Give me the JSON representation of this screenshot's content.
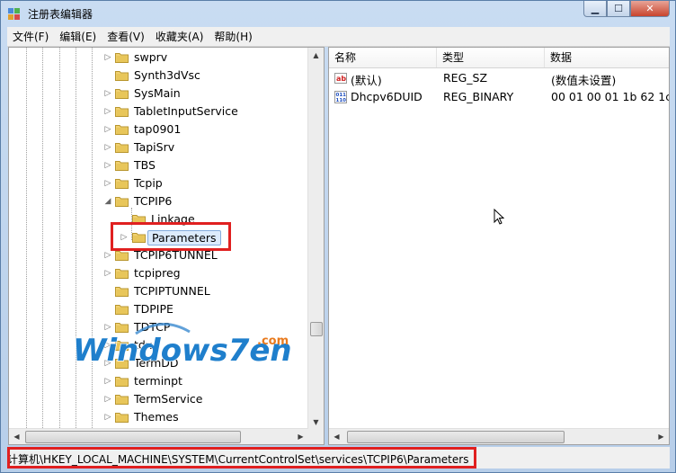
{
  "window": {
    "title": "注册表编辑器"
  },
  "menu": [
    {
      "label": "文件(F)"
    },
    {
      "label": "编辑(E)"
    },
    {
      "label": "查看(V)"
    },
    {
      "label": "收藏夹(A)"
    },
    {
      "label": "帮助(H)"
    }
  ],
  "tree": {
    "items": [
      {
        "label": "swprv"
      },
      {
        "label": "Synth3dVsc"
      },
      {
        "label": "SysMain"
      },
      {
        "label": "TabletInputService"
      },
      {
        "label": "tap0901"
      },
      {
        "label": "TapiSrv"
      },
      {
        "label": "TBS"
      },
      {
        "label": "Tcpip"
      },
      {
        "label": "TCPIP6"
      },
      {
        "label": "Linkage"
      },
      {
        "label": "Parameters"
      },
      {
        "label": "TCPIP6TUNNEL"
      },
      {
        "label": "tcpipreg"
      },
      {
        "label": "TCPIPTUNNEL"
      },
      {
        "label": "TDPIPE"
      },
      {
        "label": "TDTCP"
      },
      {
        "label": "tdx"
      },
      {
        "label": "TermDD"
      },
      {
        "label": "terminpt"
      },
      {
        "label": "TermService"
      },
      {
        "label": "Themes"
      }
    ]
  },
  "list": {
    "columns": [
      "名称",
      "类型",
      "数据"
    ],
    "rows": [
      {
        "icon": "string-value-icon",
        "name": "(默认)",
        "type": "REG_SZ",
        "data": "(数值未设置)"
      },
      {
        "icon": "binary-value-icon",
        "name": "Dhcpv6DUID",
        "type": "REG_BINARY",
        "data": "00 01 00 01 1b 62 1c 6"
      }
    ]
  },
  "status": {
    "path": "计算机\\HKEY_LOCAL_MACHINE\\SYSTEM\\CurrentControlSet\\services\\TCPIP6\\Parameters"
  },
  "watermark": {
    "text": "Windows7en",
    "suffix": ".com"
  },
  "colors": {
    "highlight": "#e02020",
    "folder": "#e8c65a",
    "title_bg": "#c9dcf2"
  }
}
